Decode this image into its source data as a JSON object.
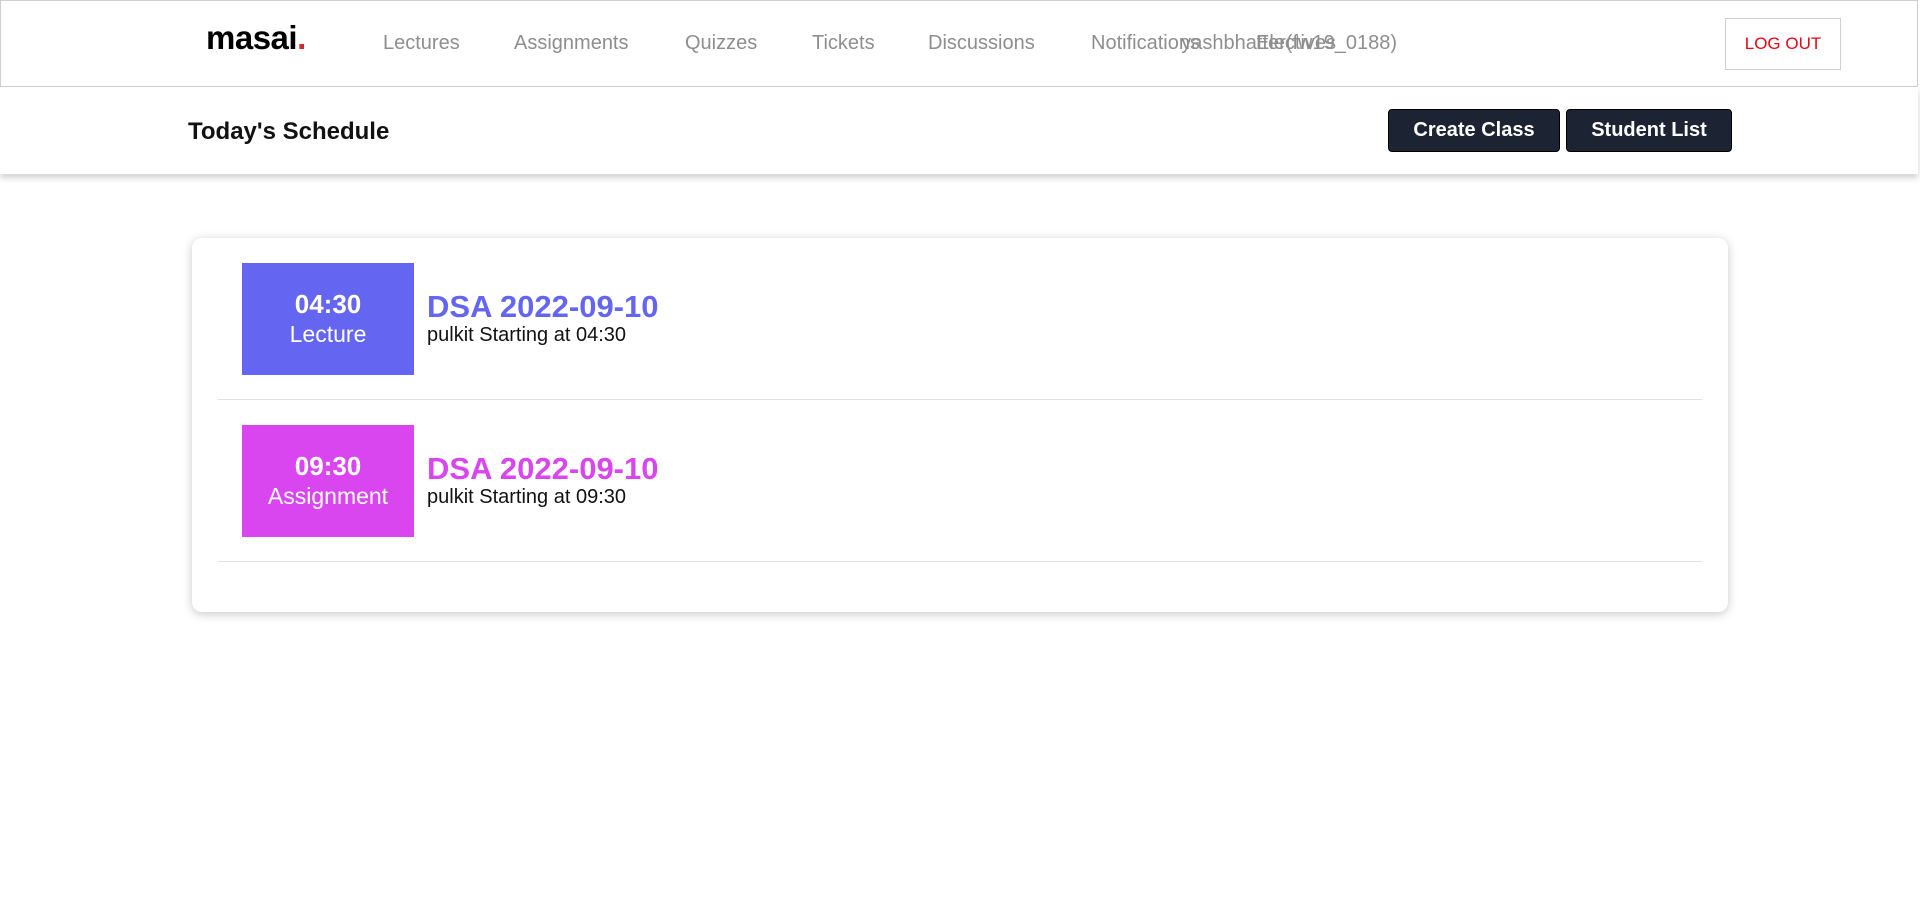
{
  "nav": {
    "logo": "masai",
    "logo_dot": ".",
    "items": [
      {
        "label": "Lectures"
      },
      {
        "label": "Assignments"
      },
      {
        "label": "Quizzes"
      },
      {
        "label": "Tickets"
      },
      {
        "label": "Discussions"
      },
      {
        "label": "Notifications"
      },
      {
        "label": "Electives"
      }
    ],
    "username": "yashbhatter(fw19_0188)",
    "logout_label": "LOG OUT"
  },
  "header": {
    "title": "Today's Schedule",
    "create_class_label": "Create Class",
    "student_list_label": "Student List"
  },
  "schedule": [
    {
      "time": "04:30",
      "type": "Lecture",
      "title": "DSA 2022-09-10",
      "subtitle": "pulkit Starting at 04:30",
      "color": "#6466f1"
    },
    {
      "time": "09:30",
      "type": "Assignment",
      "title": "DSA 2022-09-10",
      "subtitle": "pulkit Starting at 09:30",
      "color": "#d946ef"
    }
  ],
  "colors": {
    "logout_text": "#e30613",
    "dark_button": "#1c2433",
    "nav_text": "#8e8e8e"
  }
}
